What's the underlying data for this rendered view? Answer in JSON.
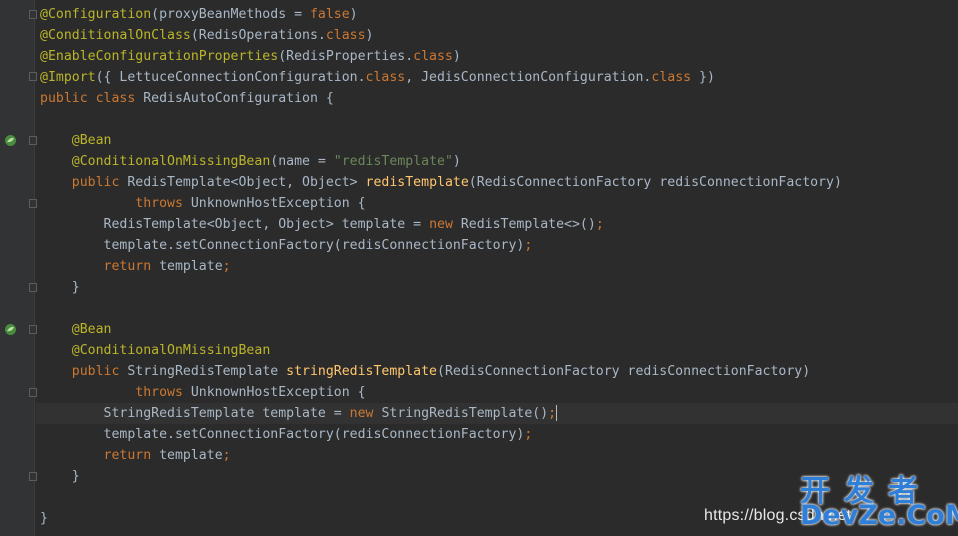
{
  "editor": {
    "l1": {
      "ann": "@Configuration",
      "p": "(proxyBeanMethods = ",
      "kw": "false",
      "e": ")"
    },
    "l2": {
      "ann": "@ConditionalOnClass",
      "p": "(RedisOperations.",
      "kw": "class",
      "e": ")"
    },
    "l3": {
      "ann": "@EnableConfigurationProperties",
      "p": "(RedisProperties.",
      "kw": "class",
      "e": ")"
    },
    "l4": {
      "ann": "@Import",
      "p1": "({ LettuceConnectionConfiguration.",
      "kw1": "class",
      "p2": ", JedisConnectionConfiguration.",
      "kw2": "class",
      "e": " })"
    },
    "l5": {
      "kw1": "public",
      "kw2": "class",
      "p": " RedisAutoConfiguration {"
    },
    "l7": {
      "ann": "@Bean"
    },
    "l8": {
      "ann": "@ConditionalOnMissingBean",
      "p": "(name = ",
      "str": "\"redisTemplate\"",
      "e": ")"
    },
    "l9": {
      "kw": "public",
      "p1": " RedisTemplate<Object, Object> ",
      "fn": "redisTemplate",
      "p2": "(RedisConnectionFactory redisConnectionFactory)"
    },
    "l10": {
      "kw": "throws",
      "p": " UnknownHostException {"
    },
    "l11": {
      "p1": "RedisTemplate<Object, Object> template = ",
      "kw": "new",
      "p2": " RedisTemplate<>()",
      "e": ";"
    },
    "l12": {
      "p": "template.setConnectionFactory(redisConnectionFactory)",
      "e": ";"
    },
    "l13": {
      "kw": "return",
      "p": " template",
      "e": ";"
    },
    "l14": {
      "p": "}"
    },
    "l16": {
      "ann": "@Bean"
    },
    "l17": {
      "ann": "@ConditionalOnMissingBean"
    },
    "l18": {
      "kw": "public",
      "p1": " StringRedisTemplate ",
      "fn": "stringRedisTemplate",
      "p2": "(RedisConnectionFactory redisConnectionFactory)"
    },
    "l19": {
      "kw": "throws",
      "p": " UnknownHostException {"
    },
    "l20": {
      "p1": "StringRedisTemplate template = ",
      "kw": "new",
      "p2": " StringRedisTemplate()",
      "e": ";"
    },
    "l21": {
      "p": "template.setConnectionFactory(redisConnectionFactory)",
      "e": ";"
    },
    "l22": {
      "kw": "return",
      "p": " template",
      "e": ";"
    },
    "l23": {
      "p": "}"
    },
    "l25": {
      "p": "}"
    }
  },
  "gutter": {
    "icon": "spring-bean-icon"
  },
  "watermark": {
    "url": "https://blog.csdn.net",
    "cn": "开发者",
    "en": "DevZe.CoM"
  },
  "colors": {
    "background": "#2b2b2b",
    "annotation": "#bbb529",
    "keyword": "#cc7832",
    "string": "#6a8759",
    "method": "#ffc66d",
    "text": "#a9b7c6"
  }
}
